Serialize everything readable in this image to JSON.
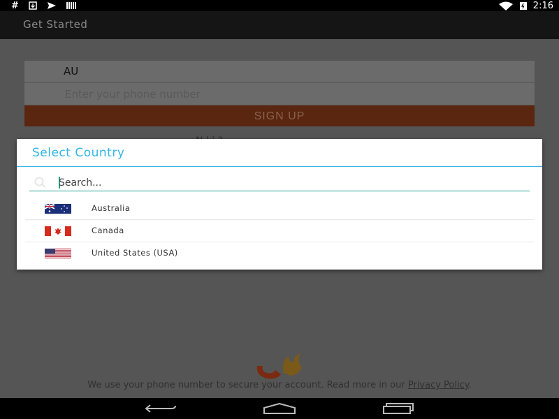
{
  "status_bar": {
    "left_icons": [
      "hash-icon",
      "download-icon",
      "send-icon",
      "barcode-icon"
    ],
    "right_icons": [
      "wifi-icon",
      "battery-icon"
    ],
    "time": "2:16"
  },
  "action_bar": {
    "title": "Get Started"
  },
  "form": {
    "country_code": "AU",
    "phone_placeholder": "Enter your phone number",
    "signup_label": "SIGN UP",
    "partial_text": "N              l              i          ?"
  },
  "footer": {
    "text": "We use your phone number to secure your account. Read more in our ",
    "link": "Privacy Policy",
    "suffix": "."
  },
  "dialog": {
    "title": "Select Country",
    "search_placeholder": "Search...",
    "countries": [
      {
        "name": "Australia",
        "flag": "australia-flag-icon"
      },
      {
        "name": "Canada",
        "flag": "canada-flag-icon"
      },
      {
        "name": "United States (USA)",
        "flag": "usa-flag-icon"
      }
    ]
  },
  "nav_bar": {
    "buttons": [
      "back-icon",
      "home-icon",
      "recents-icon"
    ]
  },
  "colors": {
    "accent": "#33b5e5",
    "search_underline": "#23a08a",
    "signup_bg": "#5a2610"
  }
}
